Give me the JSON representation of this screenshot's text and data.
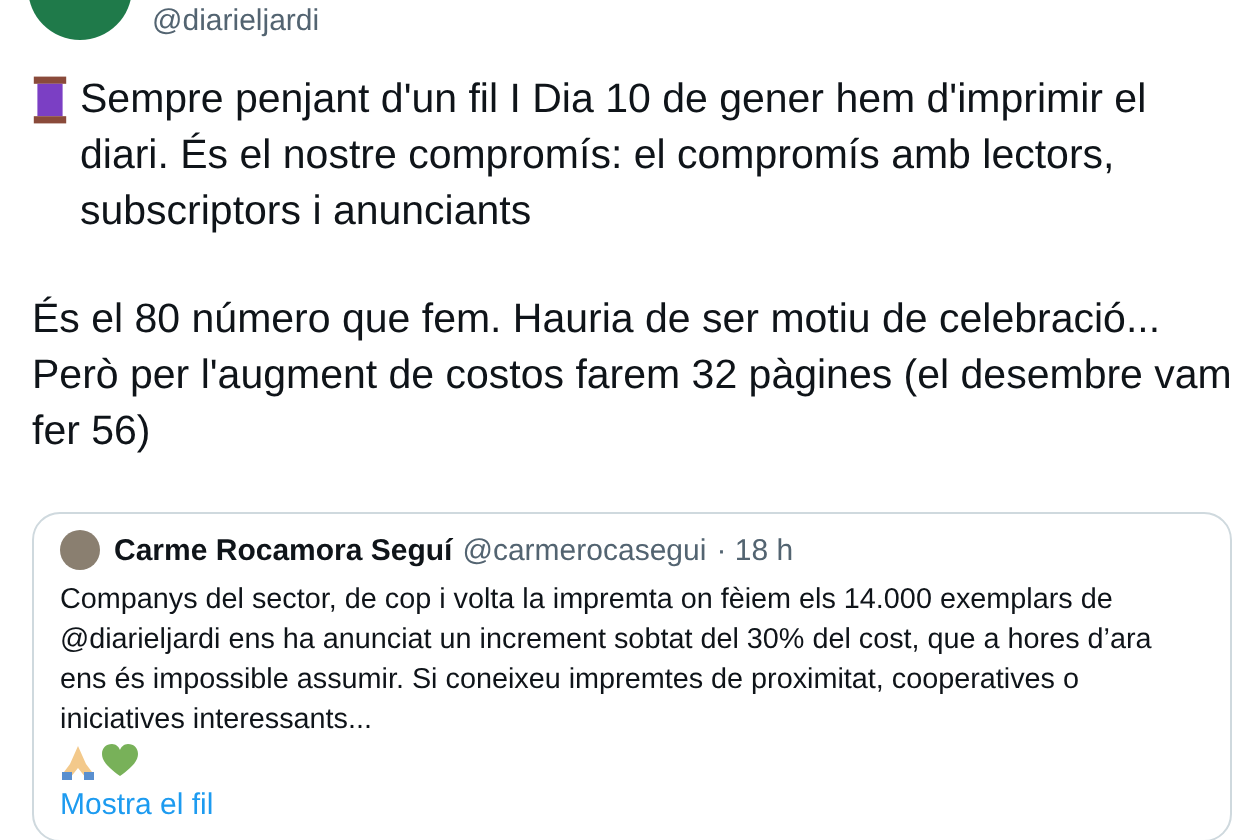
{
  "author": {
    "handle": "@diarieljardi"
  },
  "paragraphs": [
    "Sempre penjant d'un fil I Dia 10 de gener hem d'imprimir el diari. És el nostre compromís: el compromís amb lectors, subscriptors i anunciants",
    "És el 80 número que fem. Hauria de ser motiu de celebració... Però per l'augment de costos farem 32 pàgines (el desembre vam fer 56)"
  ],
  "quoted": {
    "name": "Carme Rocamora Seguí",
    "handle": "@carmerocasegui",
    "time": "· 18 h",
    "text": "Companys del sector, de cop i volta la impremta on fèiem els 14.000 exemplars de @diarieljardi ens ha anunciat un increment sobtat del 30% del cost, que a hores d’ara ens és impossible assumir. Si coneixeu impremtes de proximitat, cooperatives o iniciatives interessants...",
    "link": "Mostra el fil"
  }
}
